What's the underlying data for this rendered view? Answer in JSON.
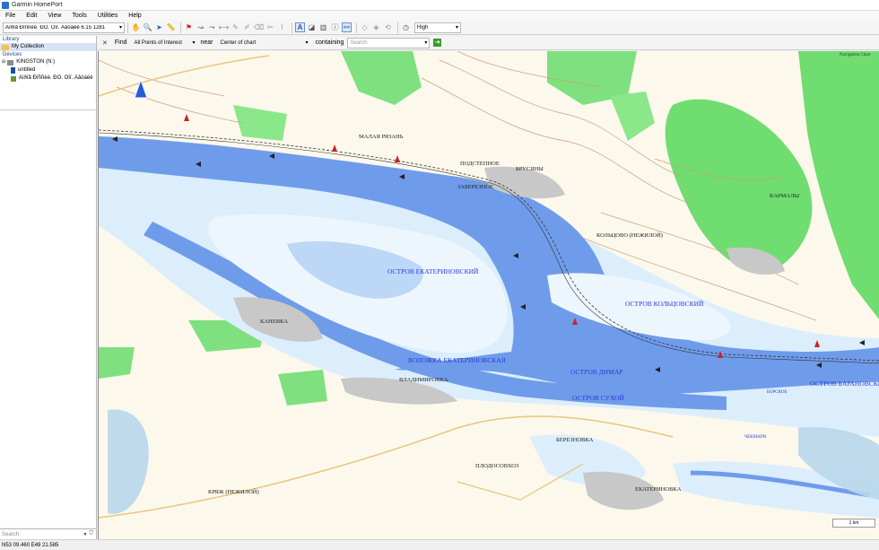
{
  "window": {
    "title": "Garmin HomePort"
  },
  "menu": [
    "File",
    "Edit",
    "View",
    "Tools",
    "Utilities",
    "Help"
  ],
  "toolbar": {
    "map_selector": "Äìðîå Ðîññèè. ÐÔ. Ôîï. Äåòàëè 6.15 1281",
    "detail_level": "High"
  },
  "leftpane": {
    "library_header": "Library",
    "my_collection": "My Collection",
    "devices_header": "Devices",
    "device_name": "KINGSTON (N:)",
    "device_item_1": "untitled",
    "device_item_2": "Äìðîå Ðîññèè. ÐÔ. Ôîï. Äåòàëè"
  },
  "search": {
    "placeholder": "Search"
  },
  "findbar": {
    "close": "✕",
    "find_label": "Find",
    "category": "All Points of Interest",
    "near_label": "near",
    "near_value": "Center of chart",
    "containing_label": "containing",
    "search_placeholder": "Search"
  },
  "map": {
    "navigation_chart_label": "Navigation Chart",
    "scale_label": "1 km",
    "labels": {
      "ostrov_ekaterinovsky": "ОСТРОВ ЕКАТЕРИНОВСКИЙ",
      "voloshka_ekaterinovskaya": "ВОЛОЖКА ЕКАТЕРИНОВСКАЯ",
      "ostrov_kolcovsky": "ОСТРОВ КОЛЬЦОВСКИЙ",
      "ostrov_baranovsky": "ОСТРОВ БАРАНОВСКИЙ",
      "ostrov_suhoy": "ОСТРОВ СУХОЙ",
      "ostrov_dimar": "ОСТРОВ ДИМАР",
      "malaya_ryazan": "МАЛАЯ РЯЗАНЬ",
      "brusyany": "БРУСЯНЫ",
      "kolcovo": "КОЛЬЦОВО (НЕЖИЛОЙ)",
      "karmaly": "КАРМАЛЫ",
      "vladimirovka": "ВЛАДИМИРОВКА",
      "plodosovhoz": "ПЛОДОСОВХОЗ",
      "kryazh": "КРЯЖ (НЕЖИЛОЙ)",
      "ekaterinovka": "ЕКАТЕРИНОВКА",
      "bereznovka": "БЕРЕЗНОВКА",
      "sokolye": "ЗАБЕРЕЗНОЕ",
      "kaltevka": "КАНЕВКА",
      "podstepnoe": "ПОДСТЕПНОЕ",
      "borskoe": "БОРСКОЕ",
      "chekmari": "ЧЕКМАРИ"
    }
  },
  "status": {
    "coordinates": "N53 09.460 E49 21.585"
  }
}
